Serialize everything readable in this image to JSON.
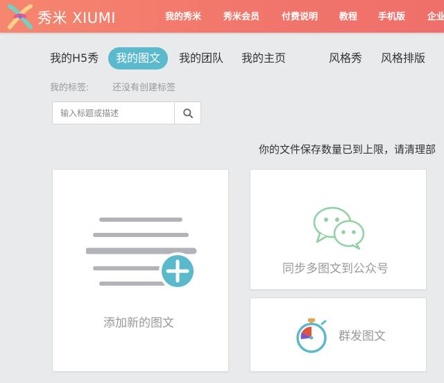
{
  "header": {
    "brand": "秀米 XIUMI",
    "nav": [
      "我的秀米",
      "秀米会员",
      "付费说明",
      "教程",
      "手机版",
      "企业"
    ]
  },
  "tabs": {
    "h5": "我的H5秀",
    "graphic": "我的图文",
    "team": "我的团队",
    "home": "我的主页",
    "style_show": "风格秀",
    "style_layout": "风格排版"
  },
  "tags": {
    "label": "我的标签:",
    "value": "还没有创建标签"
  },
  "search": {
    "placeholder": "输入标题或描述"
  },
  "notice": "你的文件保存数量已到上限，请清理部",
  "cards": {
    "add": "添加新的图文",
    "sync": "同步多图文到公众号",
    "mass": "群发图文"
  },
  "colors": {
    "accent": "#5bb9cc",
    "wechat_green": "#8fd1a0",
    "header_start": "#f6866f",
    "header_end": "#ef6f6a"
  }
}
